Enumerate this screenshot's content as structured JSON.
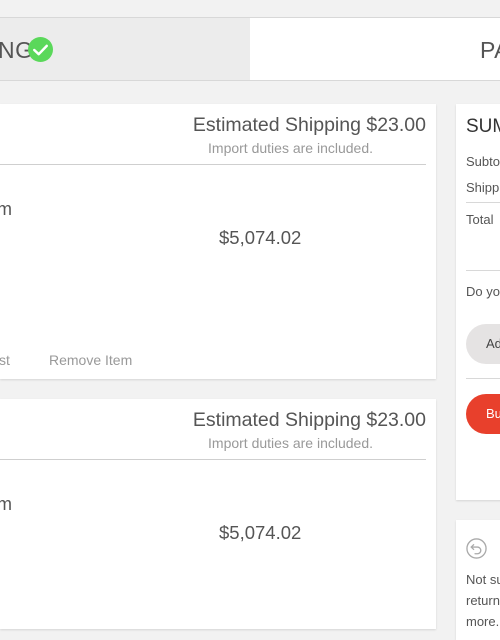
{
  "steps": {
    "shipping_label": "NG",
    "payment_label": "PA"
  },
  "items": [
    {
      "shipping": "Estimated Shipping $23.00",
      "duties": "Import duties are included.",
      "name_fragment": "m",
      "price": "$5,074.02",
      "wishlist_fragment": "st",
      "remove": "Remove Item"
    },
    {
      "shipping": "Estimated Shipping $23.00",
      "duties": "Import duties are included.",
      "name_fragment": "m",
      "price": "$5,074.02"
    }
  ],
  "summary": {
    "title": "SUM",
    "subtotal": "Subtot",
    "shipping": "Shippin",
    "total": "Total",
    "question": "Do you",
    "add_button": "Ad",
    "buy_button": "Bu"
  },
  "returns": {
    "line1": "Not su",
    "line2": "returns",
    "line3": "more."
  },
  "colors": {
    "accent_red": "#e8402c",
    "check_green": "#5ad85a"
  }
}
